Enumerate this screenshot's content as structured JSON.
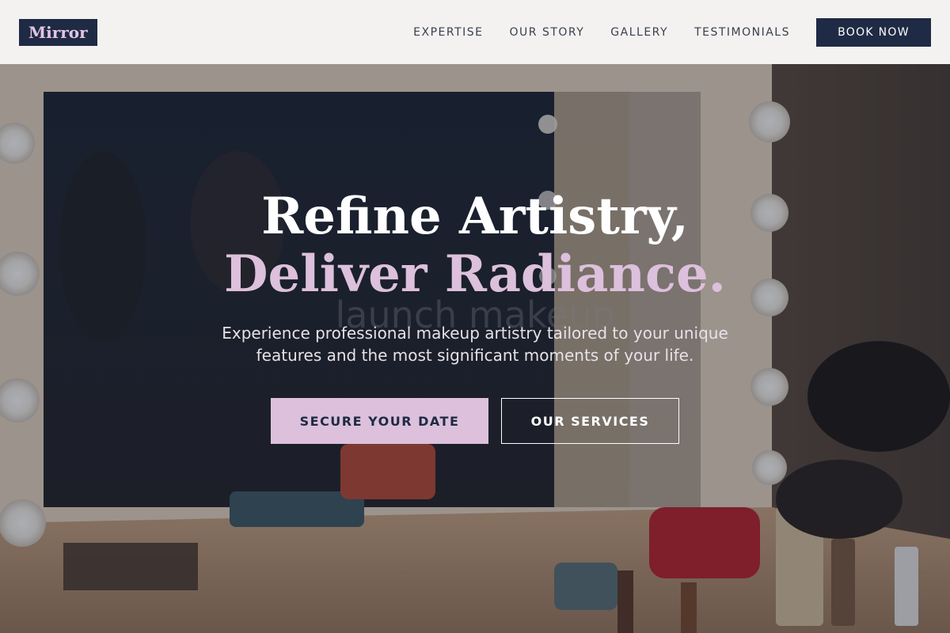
{
  "brand": {
    "logo_text": "Mirror"
  },
  "nav": {
    "items": [
      {
        "label": "EXPERTISE"
      },
      {
        "label": "OUR STORY"
      },
      {
        "label": "GALLERY"
      },
      {
        "label": "TESTIMONIALS"
      }
    ],
    "cta_label": "BOOK NOW"
  },
  "hero": {
    "headline_line1": "Refine Artistry,",
    "headline_line2": "Deliver Radiance.",
    "ghost_text": "launch makeup",
    "subtext": "Experience professional makeup artistry tailored to your unique features and the most significant moments of your life.",
    "primary_button": "SECURE YOUR DATE",
    "secondary_button": "OUR SERVICES"
  },
  "colors": {
    "navy": "#1f2a44",
    "lilac": "#dcc0dc",
    "header_bg": "#f3f2f1"
  }
}
